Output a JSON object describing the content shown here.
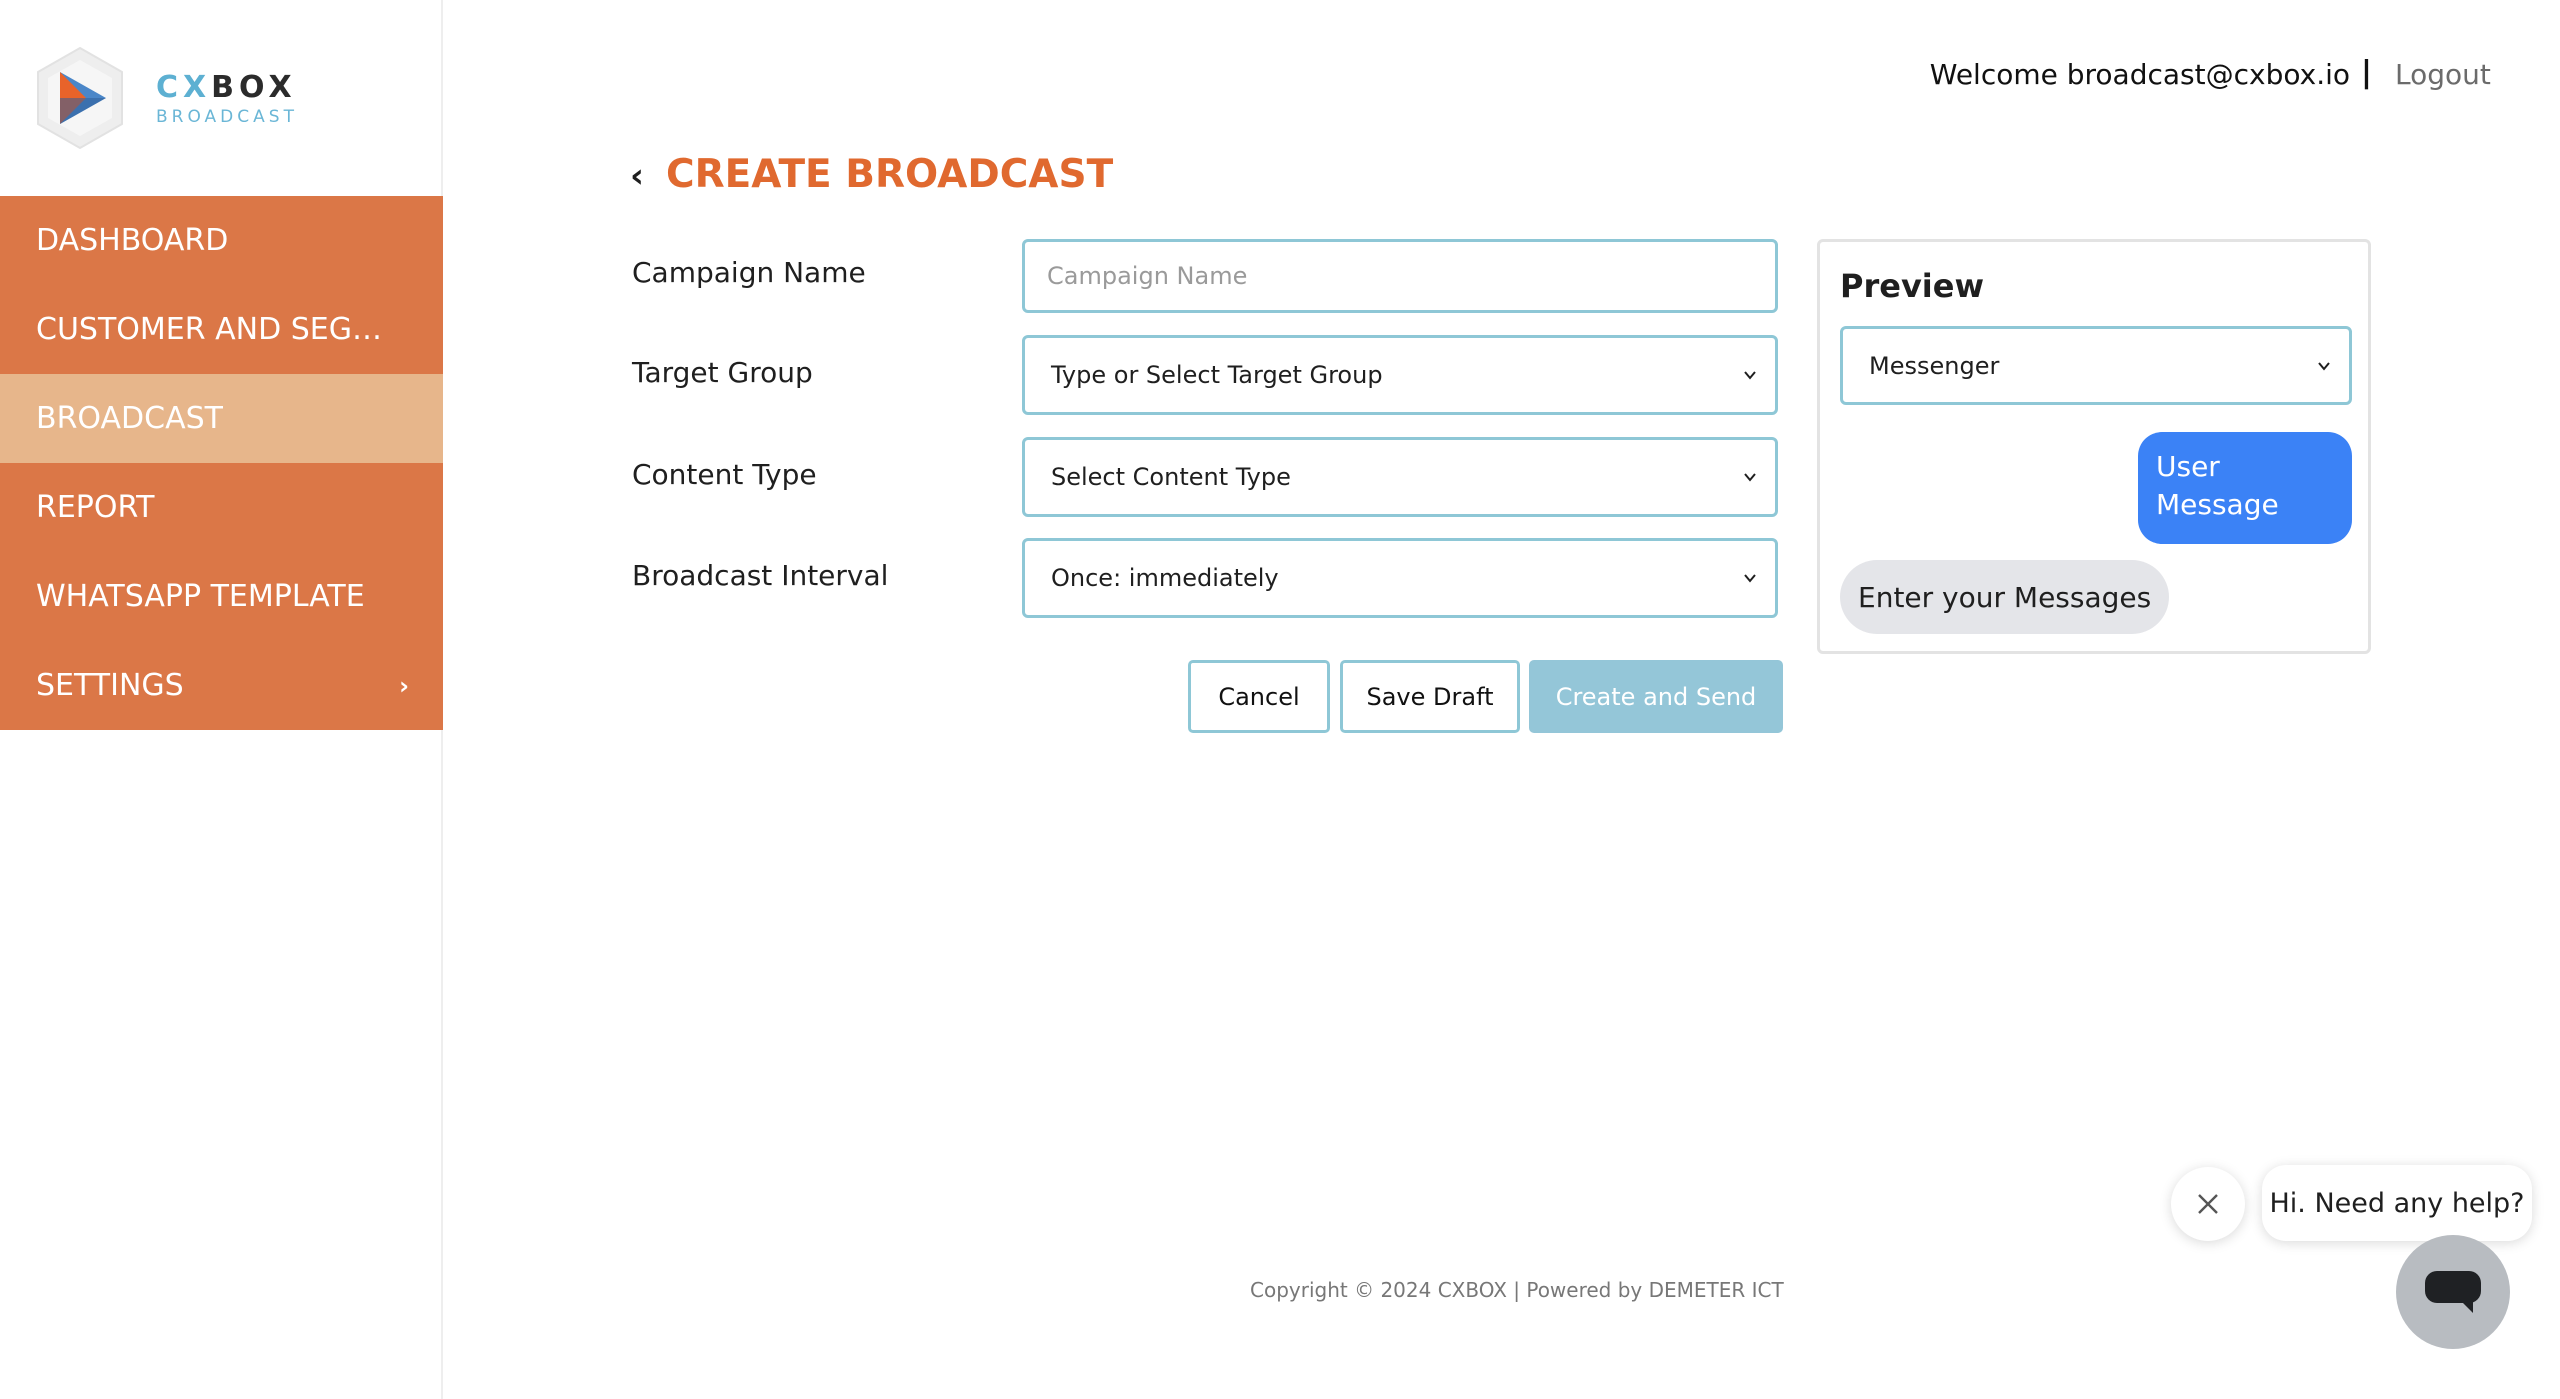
{
  "logo": {
    "title_cx": "CX",
    "title_rest": "BOX",
    "subtitle": "BROADCAST"
  },
  "sidebar": {
    "items": [
      {
        "label": "DASHBOARD",
        "active": false
      },
      {
        "label": "CUSTOMER AND SEGMENT",
        "active": false
      },
      {
        "label": "BROADCAST",
        "active": true
      },
      {
        "label": "REPORT",
        "active": false
      },
      {
        "label": "WHATSAPP TEMPLATE",
        "active": false
      },
      {
        "label": "SETTINGS",
        "active": false,
        "chevron": "›"
      }
    ]
  },
  "header": {
    "welcome": "Welcome broadcast@cxbox.io",
    "separator": "|",
    "logout": "Logout"
  },
  "page": {
    "back_glyph": "‹",
    "title": "CREATE BROADCAST"
  },
  "form": {
    "campaign_name": {
      "label": "Campaign Name",
      "placeholder": "Campaign Name",
      "value": ""
    },
    "target_group": {
      "label": "Target Group",
      "value": "Type or Select Target Group"
    },
    "content_type": {
      "label": "Content Type",
      "value": "Select Content Type"
    },
    "broadcast_interval": {
      "label": "Broadcast Interval",
      "value": "Once: immediately"
    }
  },
  "buttons": {
    "cancel": "Cancel",
    "save_draft": "Save Draft",
    "create_and_send": "Create and Send"
  },
  "preview": {
    "title": "Preview",
    "channel": "Messenger",
    "user_message": "User Message",
    "bot_message": "Enter your Messages"
  },
  "footer": {
    "copyright": "Copyright © 2024 CXBOX | Powered by DEMETER ICT"
  },
  "help_widget": {
    "greeting": "Hi. Need any help?"
  },
  "colors": {
    "sidebar_orange": "#db7747",
    "sidebar_active": "#e7b68b",
    "title_orange": "#e0692f",
    "field_border": "#8ec7d6",
    "primary_button": "#94c6d8",
    "user_bubble": "#3b82f6"
  }
}
